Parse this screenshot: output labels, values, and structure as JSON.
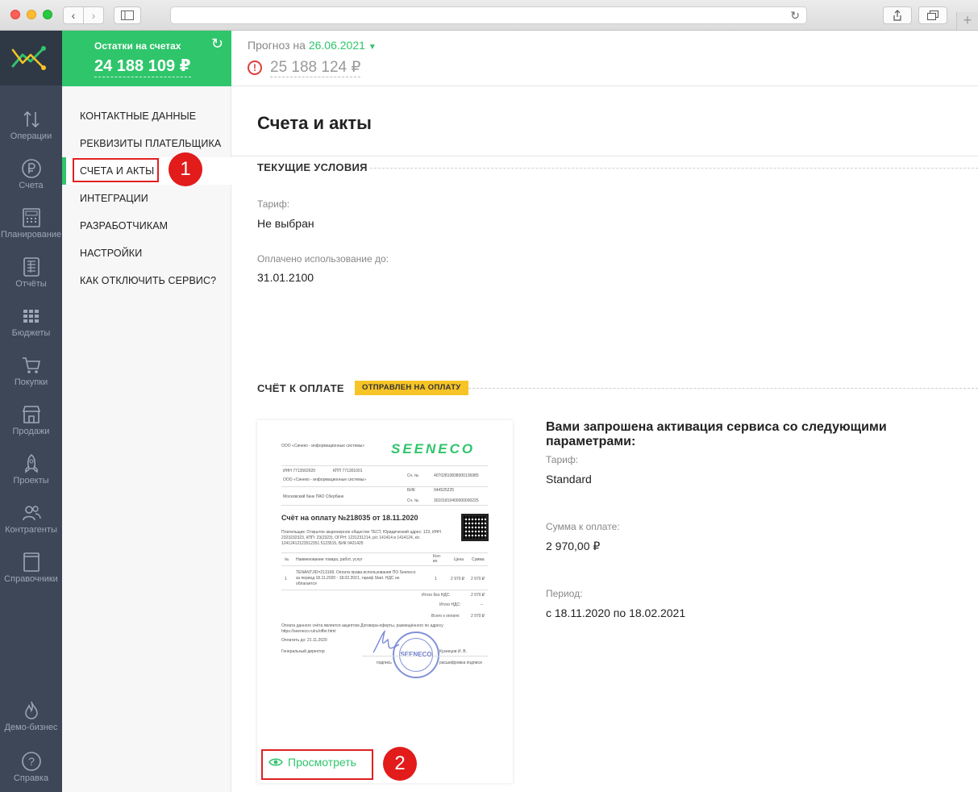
{
  "app": {
    "brand_color": "#2fc56b",
    "sidebar_color": "#3d4757"
  },
  "rail": {
    "items": [
      {
        "label": "Операции",
        "icon": "arrows-updown-icon"
      },
      {
        "label": "Счета",
        "icon": "ruble-icon"
      },
      {
        "label": "Планирование",
        "icon": "calculator-icon"
      },
      {
        "label": "Отчёты",
        "icon": "report-icon"
      },
      {
        "label": "Бюджеты",
        "icon": "grid-icon"
      },
      {
        "label": "Покупки",
        "icon": "cart-icon"
      },
      {
        "label": "Продажи",
        "icon": "store-icon"
      },
      {
        "label": "Проекты",
        "icon": "rocket-icon"
      },
      {
        "label": "Контрагенты",
        "icon": "people-icon"
      },
      {
        "label": "Справочники",
        "icon": "book-icon"
      },
      {
        "label": "Демо-бизнес",
        "icon": "flame-icon"
      },
      {
        "label": "Справка",
        "icon": "help-icon"
      }
    ]
  },
  "header": {
    "balance_caption": "Остатки на счетах",
    "balance_amount": "24 188 109 ₽",
    "forecast_caption": "Прогноз на",
    "forecast_date": "26.06.2021",
    "forecast_amount": "25 188 124 ₽"
  },
  "menu": {
    "items": [
      "КОНТАКТНЫЕ ДАННЫЕ",
      "РЕКВИЗИТЫ ПЛАТЕЛЬЩИКА",
      "СЧЕТА И АКТЫ",
      "ИНТЕГРАЦИИ",
      "РАЗРАБОТЧИКАМ",
      "НАСТРОЙКИ",
      "КАК ОТКЛЮЧИТЬ СЕРВИС?"
    ],
    "active_index": 2
  },
  "annotations": {
    "badge1": "1",
    "badge2": "2"
  },
  "main": {
    "title": "Счета и акты",
    "current_conditions": {
      "heading": "ТЕКУЩИЕ УСЛОВИЯ",
      "tariff_label": "Тариф:",
      "tariff_value": "Не выбран",
      "paid_until_label": "Оплачено использование до:",
      "paid_until_value": "31.01.2100"
    },
    "invoice": {
      "heading": "СЧЁТ К ОПЛАТЕ",
      "status": "ОТПРАВЛЕН НА ОПЛАТУ",
      "view_label": "Просмотреть",
      "preview": {
        "company": "ООО «Синеко - информационные системы»",
        "logo": "SEENECO",
        "inn": "ИНН 7713562920",
        "kpp": "КПП 771301001",
        "sch_label": "Сч. №",
        "sch_value": "40702810838000136985",
        "company2": "ООО «Синеко - информационные системы»",
        "bik_label": "БИК",
        "bik_value": "044525225",
        "bank": "Московский банк ПАО Сбербанк",
        "ks_label": "Сч. №",
        "ks_value": "30101810400000000225",
        "title": "Счёт на оплату №218035 от 18.11.2020",
        "payer_1": "Плательщик: Открытое акционерное общество ТЕСТ, Юридический адрес: 123, ИНН",
        "payer_2": "2323232323, КПП: 23(2323), ОГРН: 1231231214, р/с 141414 в 1414124, к/с",
        "payer_3": "12412412123512351 5123515, БИК 0421425",
        "col_n": "№",
        "col_name": "Наименование товара, работ, услуг",
        "col_qty": "Кол-во",
        "col_price": "Цена",
        "col_sum": "Сумма",
        "row_n": "1",
        "row_desc_1": "TENANTJID=213168, Оплата права использования ПО Seeneco",
        "row_desc_2": "за период 18.11.2020 - 18.02.2021, тариф Start. НДС не",
        "row_desc_3": "облагается",
        "row_qty": "1",
        "row_price": "2 970 ₽",
        "row_sum": "2 970 ₽",
        "total_no_vat_label": "Итого без НДС:",
        "total_no_vat": "2 970 ₽",
        "vat_label": "Итого НДС:",
        "vat": "–",
        "total_label": "Всего к оплате:",
        "total": "2 970 ₽",
        "note_1": "Оплата данного счёта является акцептом Договора-оферты, размещённого по адресу",
        "note_2": "https://seeneco.ru/ru/offer.html",
        "pay_until": "Оплатить до: 21.11.2020",
        "director": "Генеральный директор",
        "signer": "Кузнецов И. В.",
        "sign_label": "подпись",
        "sign_decode": "расшифровка подписи",
        "stamp_text": "SEENECO"
      }
    },
    "activation": {
      "title": "Вами запрошена активация сервиса со следующими параметрами:",
      "tariff_label": "Тариф:",
      "tariff_value": "Standard",
      "amount_label": "Сумма к оплате:",
      "amount_value": "2 970,00 ₽",
      "period_label": "Период:",
      "period_value": "с 18.11.2020 по 18.02.2021"
    }
  }
}
